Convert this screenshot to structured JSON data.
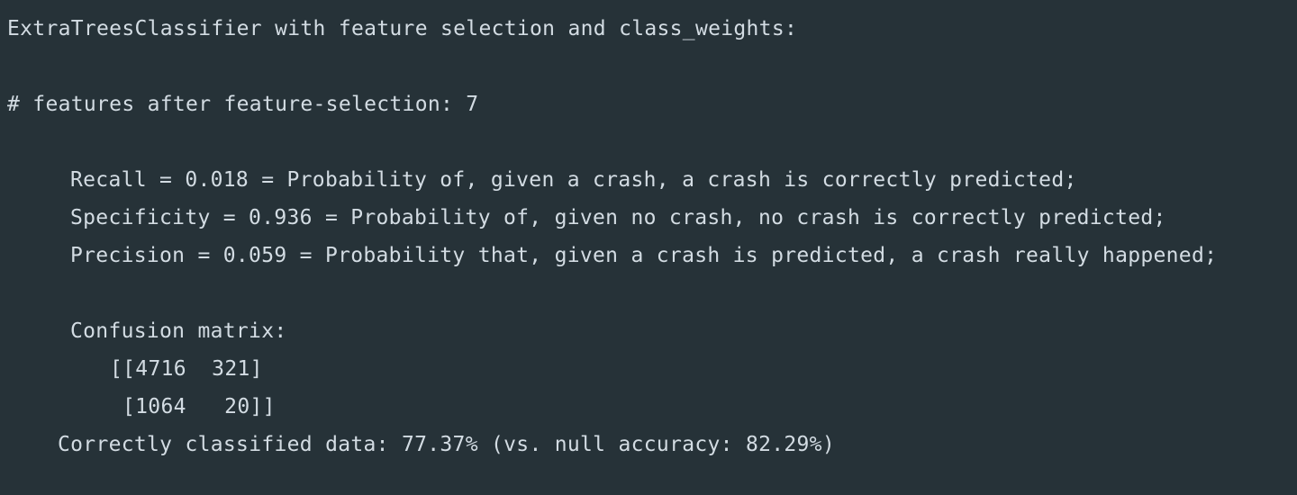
{
  "output": {
    "header": "ExtraTreesClassifier with feature selection and class_weights:",
    "features_line": "# features after feature-selection: 7",
    "metrics": {
      "recall": "Recall = 0.018 = Probability of, given a crash, a crash is correctly predicted;",
      "specificity": "Specificity = 0.936 = Probability of, given no crash, no crash is correctly predicted;",
      "precision": "Precision = 0.059 = Probability that, given a crash is predicted, a crash really happened;"
    },
    "confusion": {
      "label": "Confusion matrix:",
      "row1": "[[4716  321]",
      "row2": "[1064   20]]"
    },
    "accuracy_line": "Correctly classified data: 77.37% (vs. null accuracy: 82.29%)"
  }
}
